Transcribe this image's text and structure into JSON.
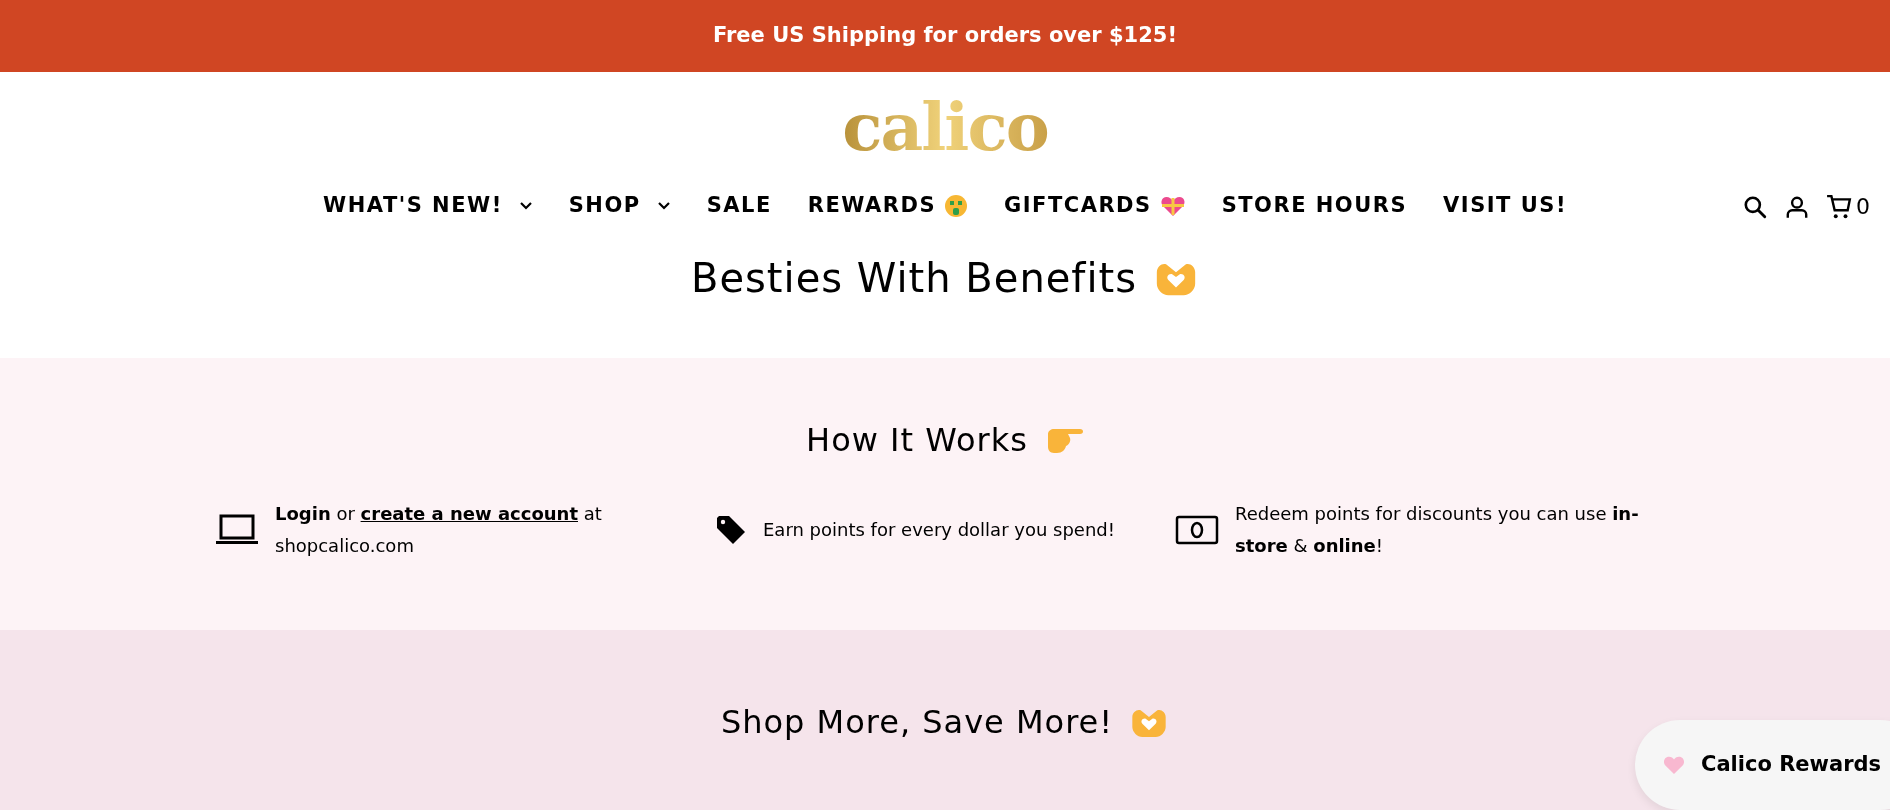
{
  "announcement": "Free US Shipping for orders over $125!",
  "logo": "calico",
  "header_icons": {
    "cart_count": "0"
  },
  "nav": [
    {
      "label": "WHAT'S NEW!",
      "kind": "dropdown"
    },
    {
      "label": "SHOP",
      "kind": "dropdown"
    },
    {
      "label": "SALE",
      "kind": "link"
    },
    {
      "label": "REWARDS",
      "kind": "money"
    },
    {
      "label": "GIFTCARDS",
      "kind": "gift"
    },
    {
      "label": "STORE HOURS",
      "kind": "link"
    },
    {
      "label": "VISIT US!",
      "kind": "link"
    }
  ],
  "page_title": "Besties With Benefits",
  "how_it_works": {
    "title": "How It Works",
    "steps": [
      {
        "kind": "laptop",
        "parts": [
          {
            "kind": "text",
            "text": "**Login** or"
          },
          {
            "kind": "link",
            "text": "create a new account"
          },
          {
            "kind": "text",
            "text": "at shopcalico.com"
          }
        ]
      },
      {
        "kind": "tag",
        "text": "Earn points for every dollar you spend!"
      },
      {
        "kind": "cash",
        "text": "Redeem points for discounts you can use **in-store** & **online**!"
      }
    ]
  },
  "shop_more": {
    "title": "Shop More, Save More!"
  },
  "rewards_button": "Calico Rewards"
}
